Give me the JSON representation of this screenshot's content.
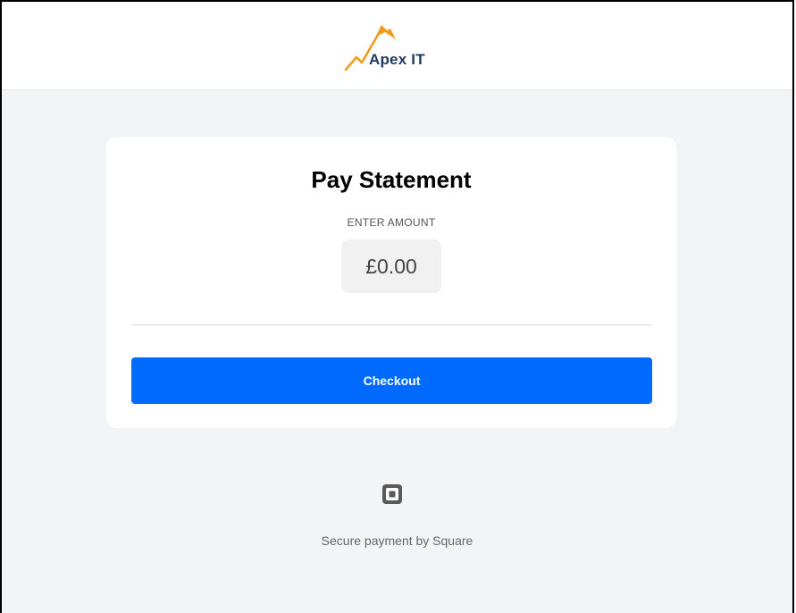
{
  "header": {
    "logo_text": "Apex IT"
  },
  "card": {
    "title": "Pay Statement",
    "amount_label": "ENTER AMOUNT",
    "amount_value": "£0.00",
    "checkout_label": "Checkout"
  },
  "footer": {
    "secure_text": "Secure payment by Square",
    "icon": "square-logo-icon"
  },
  "colors": {
    "accent": "#006aff",
    "background": "#f3f4f6",
    "logo_orange": "#f39a1e",
    "logo_text": "#1f3a5f"
  }
}
